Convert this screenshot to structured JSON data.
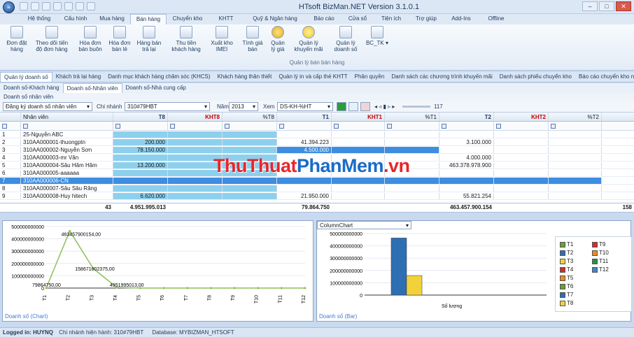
{
  "window": {
    "title": "HTsoft BizMan.NET Version 3.1.0.1",
    "app_icon": "app-icon",
    "controls": [
      "–",
      "□",
      "✕"
    ]
  },
  "menu": [
    "Hệ thống",
    "Cấu hình",
    "Mua hàng",
    "Bán hàng",
    "Chuyển kho",
    "KHTT",
    "Quỹ & Ngân hàng",
    "Báo cáo",
    "Cửa sổ",
    "Tiện ích",
    "Trợ giúp",
    "Add-Ins",
    "Offline"
  ],
  "ribbon": {
    "buttons": [
      {
        "label": "Đơn đặt\nhàng",
        "icon": "order-icon"
      },
      {
        "label": "Theo dõi tiến\nđộ đơn hàng",
        "icon": "progress-icon"
      },
      {
        "label": "Hóa đơn\nbán buôn",
        "icon": "invoice-icon"
      },
      {
        "label": "Hóa đơn\nbán lẻ",
        "icon": "receipt-icon"
      },
      {
        "label": "Hàng bán\ntrả lại",
        "icon": "return-icon"
      },
      {
        "label": "Thu tiền\nkhách hàng",
        "icon": "collect-icon"
      },
      {
        "label": "Xuất kho\nIMEI",
        "icon": "barcode-icon"
      },
      {
        "label": "Tính giá\nbán",
        "icon": "price-icon"
      },
      {
        "label": "Quản\nlý giá",
        "icon": "dollar-icon"
      },
      {
        "label": "Quản lý\nkhuyến mãi",
        "icon": "sale-icon"
      },
      {
        "label": "Quản lý\ndoanh số",
        "icon": "sales-icon"
      },
      {
        "label": "BC_TK",
        "icon": "report-icon"
      }
    ],
    "group_label": "Quản lý bán bán hàng"
  },
  "doc_tabs": [
    "Quản lý doanh số",
    "Khách trả lại hàng",
    "Danh mục khách hàng chăm sóc (KHCS)",
    "Khách hàng thân thiết",
    "Quản lý in và cấp thẻ KHTT",
    "Phân quyền",
    "Danh sách các chương trình khuyến mãi",
    "Danh sách phiếu chuyển kho",
    "Báo cáo chuyển kho nội b"
  ],
  "sub_tabs": [
    "Doanh số-Khách hàng",
    "Doanh số-Nhân viên",
    "Doanh số-Nhà cung cấp"
  ],
  "breadcrumb": "Doanh số nhân viên",
  "filter": {
    "register_value": "Đăng ký doanh số nhân viên",
    "branch_label": "Chi nhánh",
    "branch_value": "310#79HBT",
    "year_label": "Năm",
    "year_value": "2013",
    "view_label": "Xem",
    "view_value": "DS-KH-%HT",
    "page_count": "117"
  },
  "grid": {
    "columns": [
      "Nhân viên",
      "T8",
      "KHT8",
      "%T8",
      "T1",
      "KHT1",
      "%T1",
      "T2",
      "KHT2",
      "%T2"
    ],
    "rows": [
      {
        "no": "1",
        "name": "25-Nguyễn ABC",
        "t8": "",
        "t1": "",
        "t2": ""
      },
      {
        "no": "2",
        "name": "310AA000001-thuongptn",
        "t8": "200.000",
        "t1": "41.394.223",
        "t2": "3.100.000"
      },
      {
        "no": "3",
        "name": "310AA000002-Nguyễn Sơn",
        "t8": "78.150.000",
        "t1": "4.500.000",
        "t2": ""
      },
      {
        "no": "4",
        "name": "310AA000003-mr Vân",
        "t8": "",
        "t1": "",
        "t2": "4.000.000"
      },
      {
        "no": "5",
        "name": "310AA000004-Sâu Hăm Hăm",
        "t8": "13.200.000",
        "t1": "",
        "t2": "463.378.978.900"
      },
      {
        "no": "6",
        "name": "310AA000005-aaaaaa",
        "t8": "",
        "t1": "",
        "t2": ""
      },
      {
        "no": "7",
        "name": "310AA000006-CN",
        "t8": "",
        "t1": "",
        "t2": ""
      },
      {
        "no": "8",
        "name": "310AA000007-Sâu Sâu Răng",
        "t8": "",
        "t1": "",
        "t2": ""
      },
      {
        "no": "9",
        "name": "310AA000008-Huy hitech",
        "t8": "6.620.000",
        "t1": "21.950.000",
        "t2": "55.821.254"
      }
    ],
    "totals": {
      "count": "43",
      "t8": "4.951.995.013",
      "t1": "79.864.750",
      "t2": "463.457.900.154",
      "last": "158"
    }
  },
  "watermark": {
    "part1": "ThuThuat",
    "part2": "PhanMem",
    "part3": ".vn"
  },
  "line_chart": {
    "title": "Doanh số (Chart)",
    "y_ticks": [
      "500000000000",
      "400000000000",
      "300000000000",
      "200000000000",
      "100000000000",
      "0"
    ],
    "x_ticks": [
      "T1",
      "T2",
      "T3",
      "T4",
      "T5",
      "T6",
      "T7",
      "T8",
      "T9",
      "T10",
      "T11",
      "T12"
    ],
    "labels": [
      "463457900154,00",
      "158671002375,00",
      "79864750,00",
      "4951995013,00"
    ],
    "values": [
      79864750,
      463457900154,
      158671002375,
      4951995013,
      0,
      0,
      0,
      0,
      0,
      0,
      0,
      0
    ]
  },
  "bar_chart": {
    "type_label": "ColumnChart",
    "title": "Doanh số (Bar)",
    "xlabel": "Số lượng",
    "y_ticks": [
      "500000000000",
      "400000000000",
      "300000000000",
      "200000000000",
      "100000000000",
      "0"
    ],
    "legend": [
      {
        "name": "T1",
        "color": "#6a9f2f"
      },
      {
        "name": "T9",
        "color": "#d62b2b"
      },
      {
        "name": "T2",
        "color": "#2e6fb3"
      },
      {
        "name": "T10",
        "color": "#f08a1c"
      },
      {
        "name": "T3",
        "color": "#f2d23a"
      },
      {
        "name": "T11",
        "color": "#2c8f3c"
      },
      {
        "name": "T4",
        "color": "#c9302c"
      },
      {
        "name": "T12",
        "color": "#3d86c6"
      },
      {
        "name": "T5",
        "color": "#f08a1c"
      },
      {
        "name": "T6",
        "color": "#6a9f2f"
      },
      {
        "name": "T7",
        "color": "#2e6fb3"
      },
      {
        "name": "T8",
        "color": "#f2d23a"
      }
    ],
    "values": [
      0,
      463457900154,
      158671002375,
      0,
      0,
      0,
      0,
      0,
      0,
      0,
      0,
      0
    ]
  },
  "status": {
    "logged_label": "Logged in:",
    "user": "HUYNQ",
    "branch_text": "Chi nhánh hiện hành: 310#79HBT",
    "db_text": "Database: MYBIZMAN_HTSOFT"
  },
  "chart_data": [
    {
      "type": "line",
      "categories": [
        "T1",
        "T2",
        "T3",
        "T4",
        "T5",
        "T6",
        "T7",
        "T8",
        "T9",
        "T10",
        "T11",
        "T12"
      ],
      "series": [
        {
          "values": [
            79864750,
            463457900154,
            158671002375,
            4951995013,
            0,
            0,
            0,
            0,
            0,
            0,
            0,
            0
          ]
        }
      ],
      "title": "Doanh số (Chart)",
      "ylim": [
        0,
        500000000000
      ]
    },
    {
      "type": "bar",
      "categories": [
        "T1",
        "T2",
        "T3",
        "T4",
        "T5",
        "T6",
        "T7",
        "T8",
        "T9",
        "T10",
        "T11",
        "T12"
      ],
      "series": [
        {
          "values": [
            79864750,
            463457900154,
            158671002375,
            4951995013,
            0,
            0,
            0,
            0,
            0,
            0,
            0,
            0
          ]
        }
      ],
      "title": "Doanh số (Bar)",
      "xlabel": "Số lượng",
      "ylim": [
        0,
        500000000000
      ]
    }
  ]
}
